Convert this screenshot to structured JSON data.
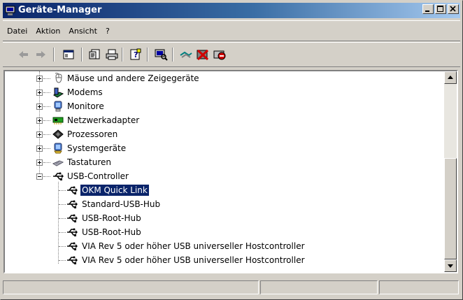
{
  "window": {
    "title": "Geräte-Manager",
    "buttons": [
      "minimize",
      "maximize",
      "close"
    ]
  },
  "menu": [
    "Datei",
    "Aktion",
    "Ansicht",
    "?"
  ],
  "toolbar": {
    "icons": [
      "back-arrow-icon",
      "forward-arrow-icon",
      "show-hide-console-tree-icon",
      "properties-icon",
      "print-icon",
      "help-icon",
      "scan-hardware-icon",
      "update-driver-icon",
      "uninstall-icon",
      "disable-device-icon"
    ]
  },
  "tree": {
    "categories": [
      {
        "label": "Mäuse und andere Zeigegeräte",
        "icon": "mouse-icon",
        "expanded": false
      },
      {
        "label": "Modems",
        "icon": "modem-icon",
        "expanded": false
      },
      {
        "label": "Monitore",
        "icon": "monitor-icon",
        "expanded": false
      },
      {
        "label": "Netzwerkadapter",
        "icon": "network-adapter-icon",
        "expanded": false
      },
      {
        "label": "Prozessoren",
        "icon": "processor-icon",
        "expanded": false
      },
      {
        "label": "Systemgeräte",
        "icon": "system-device-icon",
        "expanded": false
      },
      {
        "label": "Tastaturen",
        "icon": "keyboard-icon",
        "expanded": false
      },
      {
        "label": "USB-Controller",
        "icon": "usb-icon",
        "expanded": true
      }
    ],
    "usb_children": [
      {
        "label": "OKM Quick Link",
        "selected": true
      },
      {
        "label": "Standard-USB-Hub",
        "selected": false
      },
      {
        "label": "USB-Root-Hub",
        "selected": false
      },
      {
        "label": "USB-Root-Hub",
        "selected": false
      },
      {
        "label": "VIA Rev 5 oder höher USB universeller Hostcontroller",
        "selected": false
      },
      {
        "label": "VIA Rev 5 oder höher USB universeller Hostcontroller",
        "selected": false
      }
    ]
  },
  "colors": {
    "titlebar_start": "#0a246a",
    "titlebar_end": "#a6caf0",
    "selection": "#0a246a",
    "face": "#d4d0c8"
  }
}
